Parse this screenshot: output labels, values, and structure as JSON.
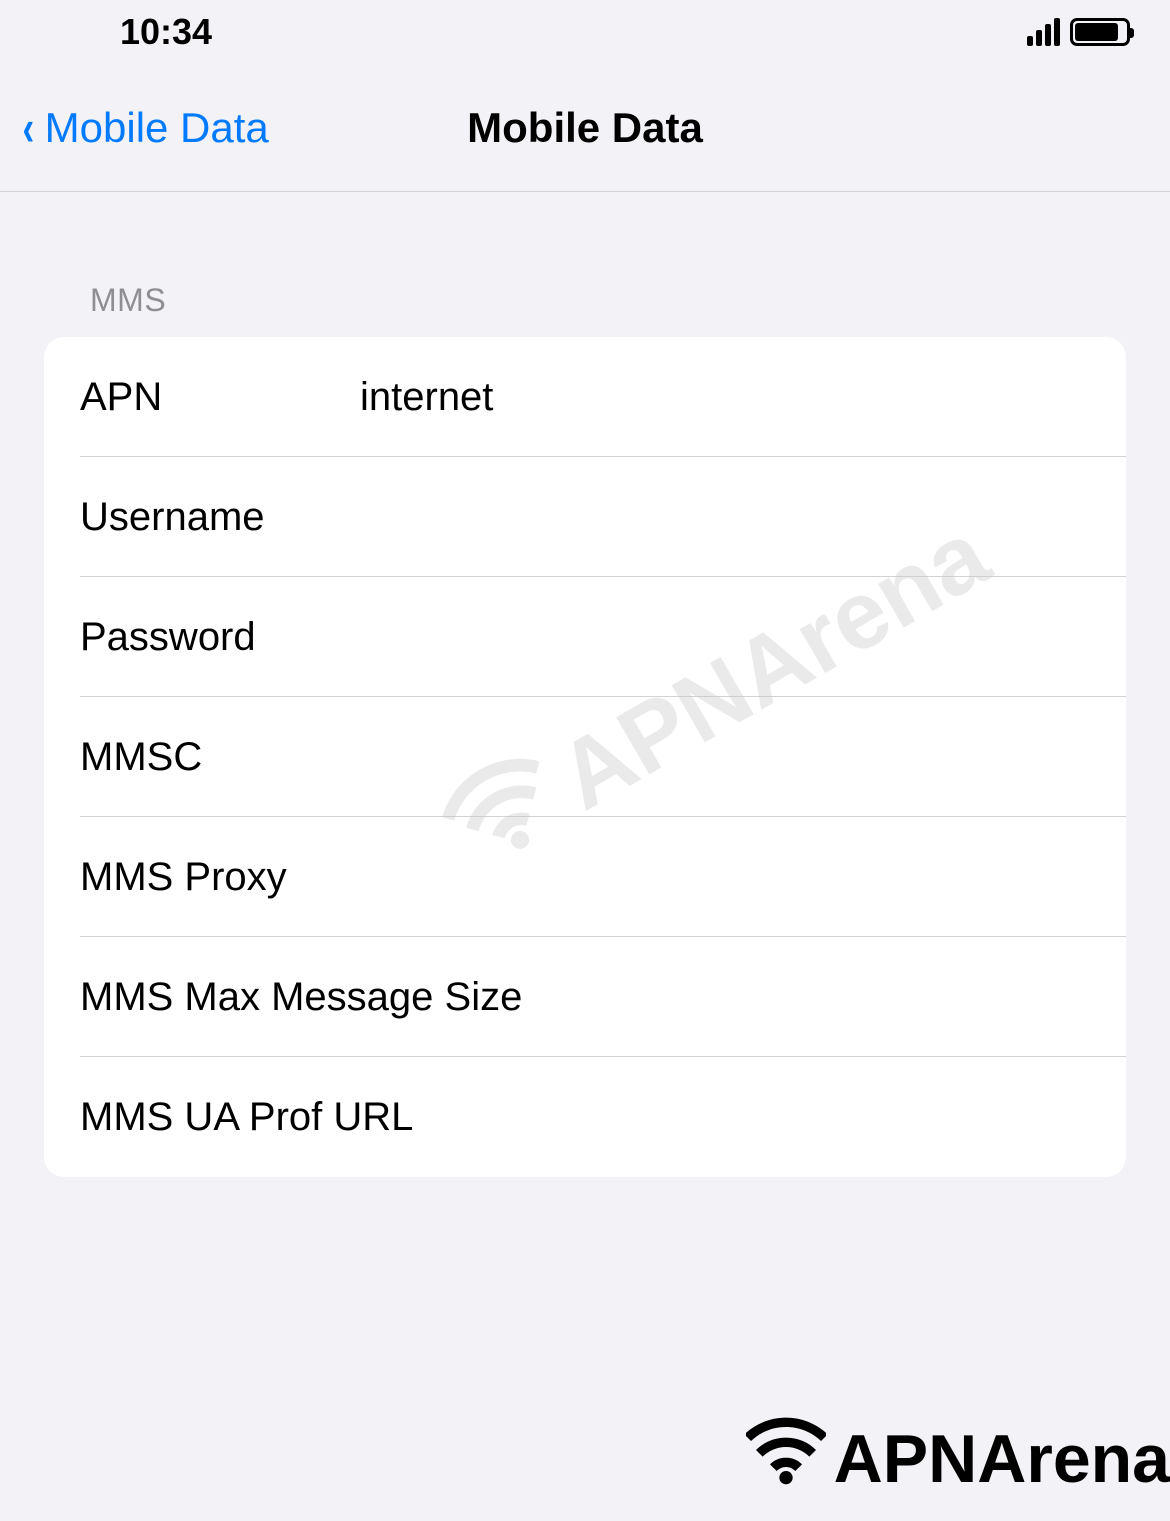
{
  "status": {
    "time": "10:34"
  },
  "nav": {
    "back_label": "Mobile Data",
    "title": "Mobile Data"
  },
  "section": {
    "header": "MMS"
  },
  "fields": {
    "apn": {
      "label": "APN",
      "value": "internet"
    },
    "username": {
      "label": "Username",
      "value": ""
    },
    "password": {
      "label": "Password",
      "value": ""
    },
    "mmsc": {
      "label": "MMSC",
      "value": ""
    },
    "mms_proxy": {
      "label": "MMS Proxy",
      "value": ""
    },
    "mms_max_size": {
      "label": "MMS Max Message Size",
      "value": ""
    },
    "mms_ua_prof": {
      "label": "MMS UA Prof URL",
      "value": ""
    }
  },
  "watermark": {
    "text": "APNArena"
  }
}
